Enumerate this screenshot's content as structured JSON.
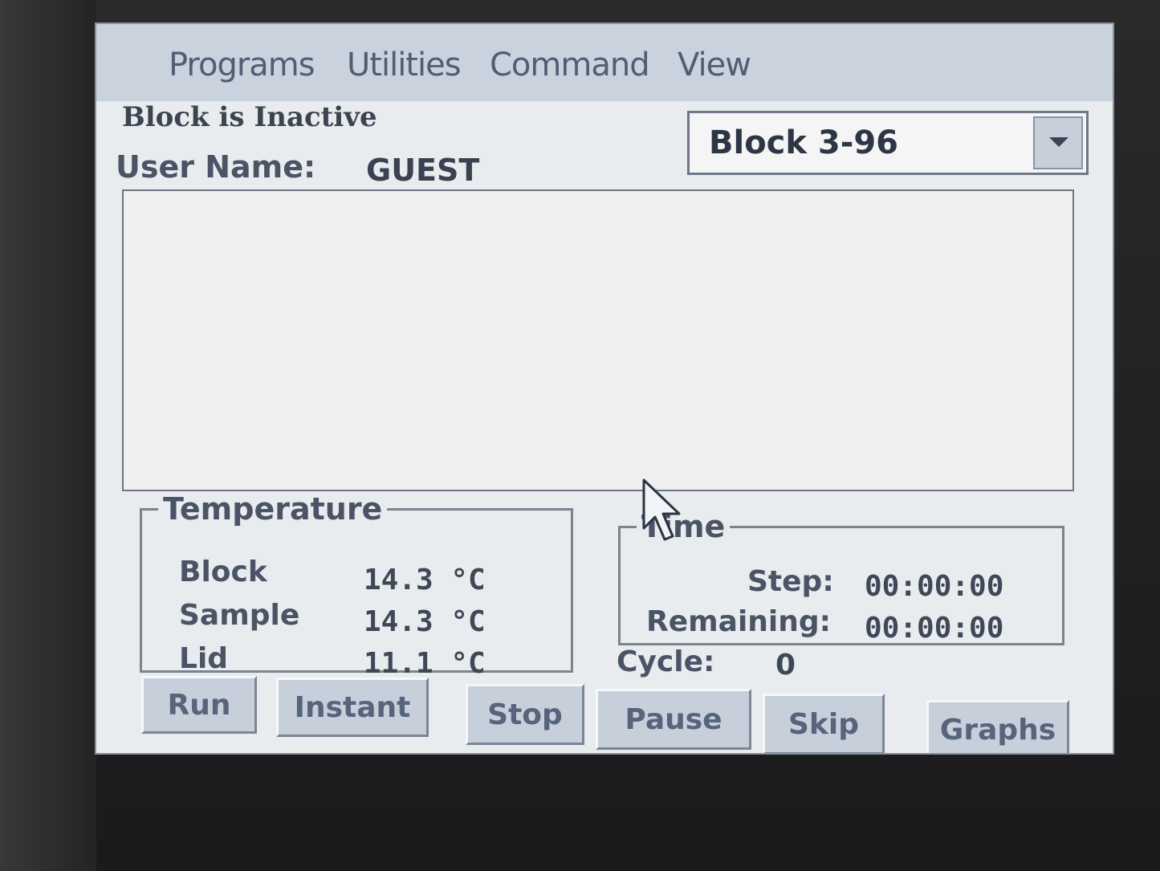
{
  "menubar": {
    "items": [
      "Programs",
      "Utilities",
      "Command",
      "View"
    ]
  },
  "status": {
    "block_state": "Block is Inactive",
    "user_label": "User Name:",
    "user_value": "GUEST"
  },
  "block_select": {
    "selected": "Block 3-96"
  },
  "temperature": {
    "legend": "Temperature",
    "rows": [
      {
        "label": "Block",
        "value": "14.3 °C"
      },
      {
        "label": "Sample",
        "value": "14.3 °C"
      },
      {
        "label": "Lid",
        "value": "11.1 °C"
      }
    ]
  },
  "time": {
    "legend": "Time",
    "step_label": "Step:",
    "step_value": "00:00:00",
    "remaining_label": "Remaining:",
    "remaining_value": "00:00:00"
  },
  "cycle": {
    "label": "Cycle:",
    "value": "0"
  },
  "buttons": {
    "run": "Run",
    "instant": "Instant",
    "stop": "Stop",
    "pause": "Pause",
    "skip": "Skip",
    "graphs": "Graphs"
  }
}
